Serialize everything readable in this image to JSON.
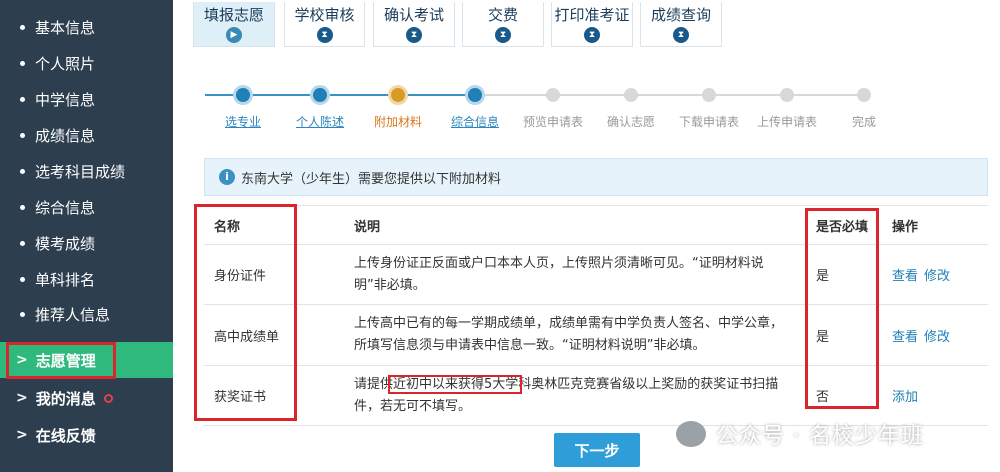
{
  "sidebar": {
    "items": [
      {
        "label": "基本信息"
      },
      {
        "label": "个人照片"
      },
      {
        "label": "中学信息"
      },
      {
        "label": "成绩信息"
      },
      {
        "label": "选考科目成绩"
      },
      {
        "label": "综合信息"
      },
      {
        "label": "模考成绩"
      },
      {
        "label": "单科排名"
      },
      {
        "label": "推荐人信息"
      }
    ],
    "sections": [
      {
        "label": "志愿管理",
        "active": true
      },
      {
        "label": "我的消息"
      },
      {
        "label": "在线反馈"
      }
    ]
  },
  "tabs": [
    {
      "label": "填报志愿",
      "icon": "play-icon",
      "active": true
    },
    {
      "label": "学校审核",
      "icon": "hourglass-icon"
    },
    {
      "label": "确认考试",
      "icon": "hourglass-icon"
    },
    {
      "label": "交费",
      "icon": "hourglass-icon"
    },
    {
      "label": "打印准考证",
      "icon": "hourglass-icon"
    },
    {
      "label": "成绩查询",
      "icon": "hourglass-icon"
    }
  ],
  "steps": [
    {
      "label": "选专业",
      "state": "done"
    },
    {
      "label": "个人陈述",
      "state": "done"
    },
    {
      "label": "附加材料",
      "state": "current"
    },
    {
      "label": "综合信息",
      "state": "done"
    },
    {
      "label": "预览申请表",
      "state": "todo"
    },
    {
      "label": "确认志愿",
      "state": "todo"
    },
    {
      "label": "下载申请表",
      "state": "todo"
    },
    {
      "label": "上传申请表",
      "state": "todo"
    },
    {
      "label": "完成",
      "state": "todo"
    }
  ],
  "info": {
    "text": "东南大学（少年生）需要您提供以下附加材料"
  },
  "table": {
    "headers": {
      "name": "名称",
      "desc": "说明",
      "required": "是否必填",
      "action": "操作"
    },
    "rows": [
      {
        "name": "身份证件",
        "desc": "上传身份证正反面或户口本本人页，上传照片须清晰可见。“证明材料说明”非必填。",
        "required": "是",
        "view": "查看",
        "edit": "修改"
      },
      {
        "name": "高中成绩单",
        "desc": "上传高中已有的每一学期成绩单，成绩单需有中学负责人签名、中学公章，所填写信息须与申请表中信息一致。“证明材料说明”非必填。",
        "required": "是",
        "view": "查看",
        "edit": "修改"
      },
      {
        "name": "获奖证书",
        "desc": "请提供近初中以来获得5大学科奥林匹克竞赛省级以上奖励的获奖证书扫描件，若无可不填写。",
        "required": "否",
        "add": "添加"
      }
    ]
  },
  "next_label": "下一步",
  "watermark": "公众号 · 名校少年班",
  "colors": {
    "sidebar": "#2d3e4f",
    "active": "#2fb97d",
    "accent": "#1f7fb6",
    "highlight": "#d9262c"
  }
}
